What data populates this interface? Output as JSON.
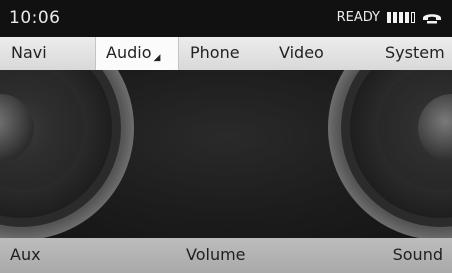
{
  "status": {
    "time": "10:06",
    "state": "READY",
    "signal_level": 4,
    "signal_max": 5,
    "phone_icon": "phone-handset-icon"
  },
  "menu": {
    "items": [
      {
        "label": "Navi"
      },
      {
        "label": "Audio"
      },
      {
        "label": "Phone"
      },
      {
        "label": "Video"
      },
      {
        "label": "System"
      }
    ],
    "selected_index": 1,
    "selected_caret": "◢"
  },
  "main": {
    "background_graphic": "speakers-icon"
  },
  "bottom": {
    "left": "Aux",
    "center": "Volume",
    "right": "Sound"
  },
  "colors": {
    "status_bg": "#111111",
    "menu_bg": "#e2e2e2",
    "main_bg": "#1c1c1c",
    "bottom_bg": "#b3b3b3"
  }
}
